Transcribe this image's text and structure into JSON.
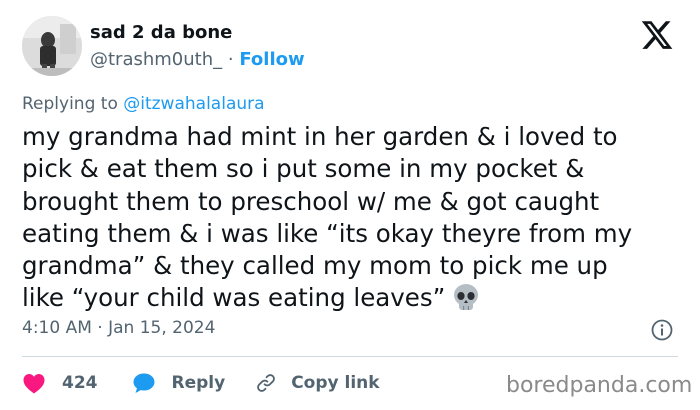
{
  "author": {
    "display_name": "sad 2 da bone",
    "handle": "@trashm0uth_",
    "separator": "·",
    "follow_label": "Follow"
  },
  "reply_context": {
    "prefix": "Replying to",
    "target": "@itzwahalalaura"
  },
  "tweet": {
    "lines": [
      "my grandma had mint in her garden & i loved to",
      "pick & eat them so i put some in my pocket &",
      "brought them to preschool w/ me & got caught",
      "eating them & i was like “its okay theyre from my",
      "grandma” & they called my mom to pick me up",
      "like “your child was eating leaves”"
    ],
    "emoji": "skull-emoji"
  },
  "meta": {
    "time": "4:10 AM",
    "separator": "·",
    "date": "Jan 15, 2024"
  },
  "actions": {
    "like_count": "424",
    "reply_label": "Reply",
    "copy_link_label": "Copy link"
  },
  "watermark": "boredpanda.com",
  "icons": {
    "brand": "x-logo-icon",
    "info": "info-icon",
    "like": "heart-icon",
    "reply": "speech-bubble-icon",
    "copy": "link-icon"
  },
  "colors": {
    "accent": "#1d9bf0",
    "like": "#f91880",
    "text": "#0f1419",
    "secondary": "#536471"
  }
}
